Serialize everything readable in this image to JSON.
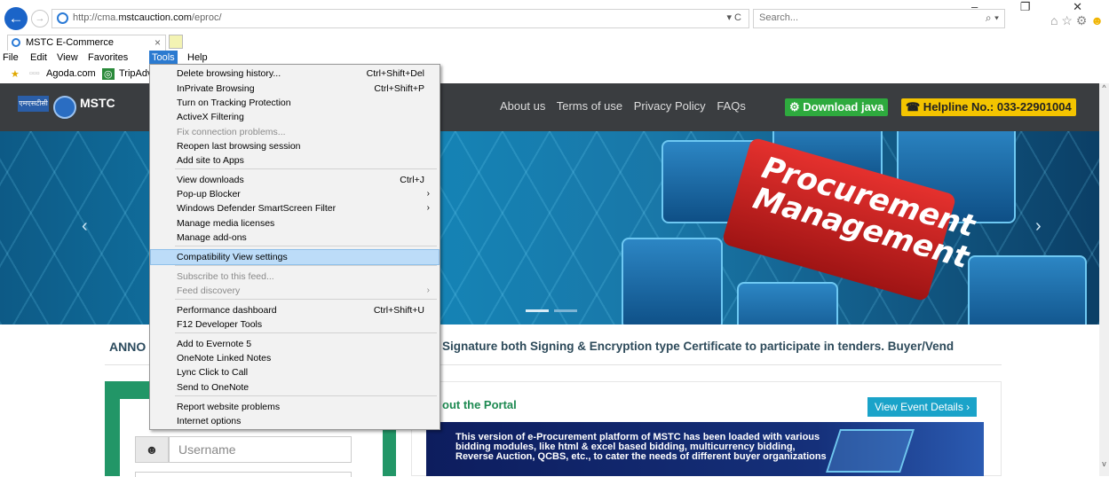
{
  "browser": {
    "url_prefix": "http://cma.",
    "url_domain": "mstcauction.com",
    "url_path": "/eproc/",
    "address_icons": "▾ C",
    "search_placeholder": "Search...",
    "search_icon": "⌕ ▾",
    "window_controls": "– ❐ ✕",
    "toolbar_icons": "⌂ ☆ ⚙",
    "smiley": "☻",
    "tab_title": "MSTC E-Commerce",
    "tab_close": "×",
    "menu": [
      "File",
      "Edit",
      "View",
      "Favorites",
      "Tools",
      "Help"
    ],
    "favorites": [
      "Agoda.com",
      "TripAdv"
    ]
  },
  "tools_menu": {
    "items": [
      {
        "label": "Delete browsing history...",
        "shortcut": "Ctrl+Shift+Del"
      },
      {
        "label": "InPrivate Browsing",
        "shortcut": "Ctrl+Shift+P"
      },
      {
        "label": "Turn on Tracking Protection"
      },
      {
        "label": "ActiveX Filtering"
      },
      {
        "label": "Fix connection problems...",
        "disabled": true
      },
      {
        "label": "Reopen last browsing session"
      },
      {
        "label": "Add site to Apps"
      },
      {
        "label": "View downloads",
        "shortcut": "Ctrl+J"
      },
      {
        "label": "Pop-up Blocker",
        "submenu": true
      },
      {
        "label": "Windows Defender SmartScreen Filter",
        "submenu": true
      },
      {
        "label": "Manage media licenses"
      },
      {
        "label": "Manage add-ons"
      },
      {
        "label": "Compatibility View settings",
        "highlighted": true
      },
      {
        "label": "Subscribe to this feed...",
        "disabled": true
      },
      {
        "label": "Feed discovery",
        "disabled": true,
        "submenu": true
      },
      {
        "label": "Performance dashboard",
        "shortcut": "Ctrl+Shift+U"
      },
      {
        "label": "F12 Developer Tools"
      },
      {
        "label": "Add to Evernote 5"
      },
      {
        "label": "OneNote Linked Notes"
      },
      {
        "label": "Lync Click to Call"
      },
      {
        "label": "Send to OneNote"
      },
      {
        "label": "Report website problems"
      },
      {
        "label": "Internet options"
      }
    ],
    "submenu_arrow": "›"
  },
  "site": {
    "logo_hindi": "एमएसटीसी",
    "logo_text": "MSTC",
    "nav": [
      "About us",
      "Terms of use",
      "Privacy Policy",
      "FAQs"
    ],
    "download_java": "⚙ Download java",
    "helpline": "☎ Helpline No.: 033-22901004",
    "hero_text_line1": "Procurement",
    "hero_text_line2": "Management",
    "hero_prev": "‹",
    "hero_next": "›",
    "announce_label": "ANNO",
    "announce_text": "Signature both Signing & Encryption type Certificate to participate in tenders. Buyer/Vend",
    "portal_title": "out the Portal",
    "event_button": "View Event Details ›",
    "portal_text": "This version of e-Procurement platform of MSTC has been loaded with various bidding modules, like html & excel based bidding, multicurrency bidding, Reverse Auction, QCBS, etc., to cater the needs of different buyer organizations",
    "username_placeholder": "Username",
    "user_icon": "☻",
    "scroll_up": "^",
    "scroll_down": "v"
  },
  "colors": {
    "header_bg": "#3a3d40",
    "java_btn": "#2eaa3e",
    "helpline_btn": "#f4c400",
    "login_green": "#229667",
    "menu_highlight": "#bcdcf8",
    "event_btn": "#1aa3c9"
  }
}
